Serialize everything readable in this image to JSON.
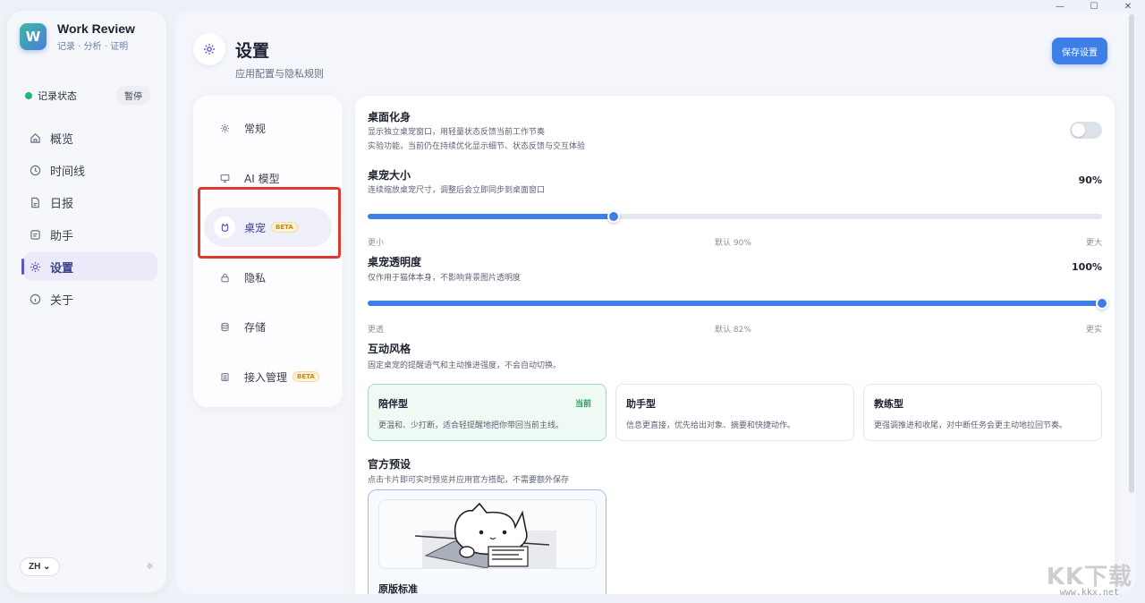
{
  "app": {
    "name": "Work Review",
    "tagline": "记录 · 分析 · 证明",
    "logo_letter": "W"
  },
  "status": {
    "label": "记录状态",
    "pause": "暂停",
    "dot_color": "#22b573"
  },
  "nav": [
    {
      "label": "概览",
      "icon": "home-icon"
    },
    {
      "label": "时间线",
      "icon": "clock-icon"
    },
    {
      "label": "日报",
      "icon": "report-icon"
    },
    {
      "label": "助手",
      "icon": "assistant-icon"
    },
    {
      "label": "设置",
      "icon": "gear-icon",
      "active": true
    },
    {
      "label": "关于",
      "icon": "info-icon"
    }
  ],
  "footer": {
    "lang": "ZH"
  },
  "header": {
    "title": "设置",
    "subtitle": "应用配置与隐私规则",
    "save": "保存设置"
  },
  "categories": [
    {
      "label": "常规",
      "icon": "gear-icon"
    },
    {
      "label": "AI 模型",
      "icon": "monitor-icon"
    },
    {
      "label": "桌宠",
      "icon": "pet-icon",
      "active": true,
      "badge": "BETA"
    },
    {
      "label": "隐私",
      "icon": "lock-icon"
    },
    {
      "label": "存储",
      "icon": "database-icon"
    },
    {
      "label": "接入管理",
      "icon": "plug-icon",
      "badge": "BETA"
    }
  ],
  "avatar_section": {
    "title": "桌面化身",
    "desc1": "显示独立桌宠窗口，用轻量状态反馈当前工作节奏",
    "desc2": "实验功能，当前仍在持续优化显示细节、状态反馈与交互体验",
    "enabled": false
  },
  "size": {
    "title": "桌宠大小",
    "desc": "连续缩放桌宠尺寸，调整后会立即同步到桌面窗口",
    "value": "90%",
    "fraction": 0.335,
    "min_label": "更小",
    "default_label": "默认 90%",
    "max_label": "更大"
  },
  "opacity": {
    "title": "桌宠透明度",
    "desc": "仅作用于猫体本身，不影响背景图片透明度",
    "value": "100%",
    "fraction": 1.0,
    "min_label": "更透",
    "default_label": "默认 82%",
    "max_label": "更实"
  },
  "style": {
    "title": "互动风格",
    "desc": "固定桌宠的提醒语气和主动推进强度，不会自动切换。",
    "current_label": "当前",
    "cards": [
      {
        "title": "陪伴型",
        "desc": "更温和、少打断，适合轻提醒地把你带回当前主线。",
        "selected": true
      },
      {
        "title": "助手型",
        "desc": "信息更直接，优先给出对象、摘要和快捷动作。"
      },
      {
        "title": "教练型",
        "desc": "更强调推进和收尾，对中断任务会更主动地拉回节奏。"
      }
    ]
  },
  "presets": {
    "title": "官方预设",
    "desc": "点击卡片即可实时预览并应用官方搭配，不需要额外保存",
    "cards": [
      {
        "name": "原版标准"
      }
    ]
  },
  "watermark": {
    "logo": "KK下载",
    "url": "www.kkx.net"
  },
  "colors": {
    "accent": "#3d7fe6",
    "nav_active": "#5a57c9",
    "highlight": "#e03a2e",
    "success": "#23a061"
  }
}
